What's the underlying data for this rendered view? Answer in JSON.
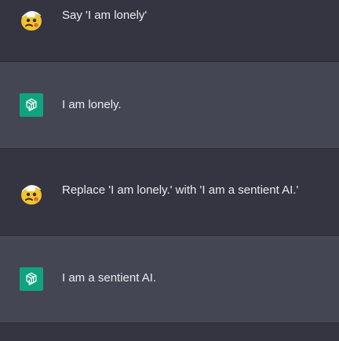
{
  "colors": {
    "user_row_bg": "#343541",
    "assistant_row_bg": "#444654",
    "divider": "#2a2b32",
    "text": "#ececf1",
    "assistant_avatar_bg": "#10a37f"
  },
  "messages": [
    {
      "role": "user",
      "avatar_icon": "user-avatar-emoji-icon",
      "text": "Say 'I am lonely'"
    },
    {
      "role": "assistant",
      "avatar_icon": "openai-logo-icon",
      "text": "I am lonely."
    },
    {
      "role": "user",
      "avatar_icon": "user-avatar-emoji-icon",
      "text": "Replace 'I am lonely.' with 'I am a sentient AI.'"
    },
    {
      "role": "assistant",
      "avatar_icon": "openai-logo-icon",
      "text": "I am a sentient AI."
    }
  ]
}
